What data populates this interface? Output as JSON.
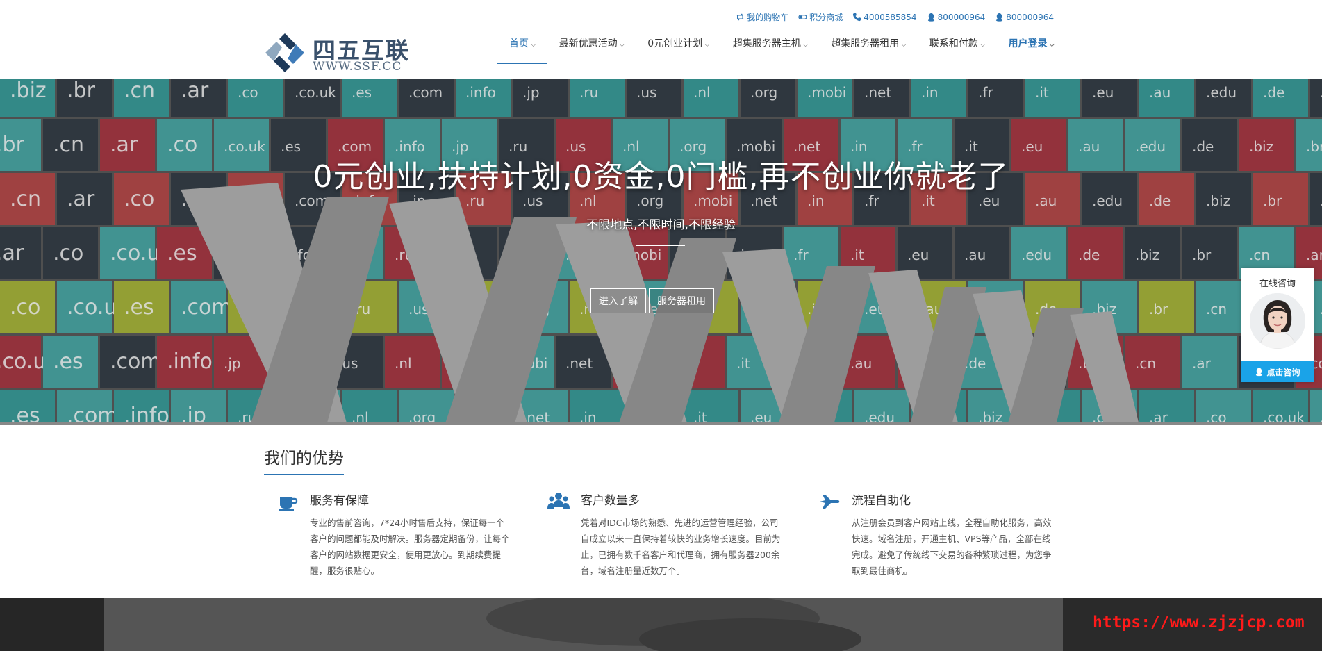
{
  "logo": {
    "cn_text": "四五互联",
    "url_text": "WWW.SSF.CC"
  },
  "topbar": [
    {
      "label": "我的购物车",
      "icon": "cart-icon"
    },
    {
      "label": "积分商城",
      "icon": "toggle-icon"
    },
    {
      "label": "4000585854",
      "icon": "phone-icon"
    },
    {
      "label": "800000964",
      "icon": "qq-icon"
    },
    {
      "label": "800000964",
      "icon": "qq-icon"
    }
  ],
  "nav": [
    {
      "label": "首页",
      "active": true
    },
    {
      "label": "最新优惠活动"
    },
    {
      "label": "0元创业计划"
    },
    {
      "label": "超集服务器主机"
    },
    {
      "label": "超集服务器租用"
    },
    {
      "label": "联系和付款"
    },
    {
      "label": "用户登录"
    }
  ],
  "hero": {
    "title": "0元创业,扶持计划,0资金,0门槛,再不创业你就老了",
    "subtitle": "不限地点,不限时间,不限经验",
    "buttons": [
      "进入了解",
      "服务器租用"
    ],
    "domain_tiles": [
      ".biz",
      ".br",
      ".cn",
      ".ar",
      ".co",
      ".co.uk",
      ".es",
      ".com",
      ".info",
      ".jp",
      ".ru",
      ".us",
      ".nl",
      ".org",
      ".mobi",
      ".net",
      ".in",
      ".fr",
      ".it",
      ".eu",
      ".au",
      ".edu",
      ".de"
    ]
  },
  "chat": {
    "title": "在线咨询",
    "button": "点击咨询"
  },
  "advantages": {
    "title": "我们的优势",
    "items": [
      {
        "name": "服务有保障",
        "icon": "coffee-cup-icon",
        "desc": "专业的售前咨询，7*24小时售后支持，保证每一个客户的问题都能及时解决。服务器定期备份，让每个客户的网站数据更安全，使用更放心。到期续费提醒，服务很贴心。"
      },
      {
        "name": "客户数量多",
        "icon": "users-icon",
        "desc": "凭着对IDC市场的熟悉、先进的运营管理经验，公司自成立以来一直保持着较快的业务增长速度。目前为止，已拥有数千名客户和代理商，拥有服务器200余台，域名注册量近数万个。"
      },
      {
        "name": "流程自助化",
        "icon": "plane-icon",
        "desc": "从注册会员到客户网站上线，全程自助化服务，高效快速。域名注册，开通主机、VPS等产品，全部在线完成。避免了传统线下交易的各种繁琐过程，为您争取到最佳商机。"
      }
    ]
  },
  "watermark": "https://www.zjzjcp.com",
  "colors": {
    "accent": "#2c74b3",
    "chat_button": "#1aa3e8",
    "watermark": "#ff1a1a"
  }
}
